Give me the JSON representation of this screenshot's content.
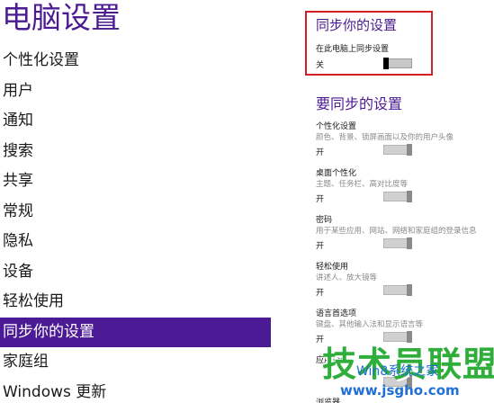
{
  "nav": {
    "title": "电脑设置",
    "items": [
      {
        "label": "个性化设置"
      },
      {
        "label": "用户"
      },
      {
        "label": "通知"
      },
      {
        "label": "搜索"
      },
      {
        "label": "共享"
      },
      {
        "label": "常规"
      },
      {
        "label": "隐私"
      },
      {
        "label": "设备"
      },
      {
        "label": "轻松使用"
      },
      {
        "label": "同步你的设置",
        "selected": true
      },
      {
        "label": "家庭组"
      },
      {
        "label": "Windows 更新"
      }
    ]
  },
  "sync": {
    "title": "同步你的设置",
    "toggle_label": "在此电脑上同步设置",
    "state": "关"
  },
  "what_to_sync": {
    "title": "要同步的设置",
    "items": [
      {
        "label": "个性化设置",
        "description": "颜色、背景、锁屏画面以及你的用户头像",
        "state": "开"
      },
      {
        "label": "桌面个性化",
        "description": "主题、任务栏、高对比度等",
        "state": "开"
      },
      {
        "label": "密码",
        "description": "用于某些应用、网站、网络和家庭组的登录信息",
        "state": "开"
      },
      {
        "label": "轻松使用",
        "description": "讲述人、放大镜等",
        "state": "开"
      },
      {
        "label": "语言首选项",
        "description": "键盘、其他输入法和显示语言等",
        "state": "开"
      },
      {
        "label": "应用设置"
      },
      {
        "label": "浏览器"
      }
    ]
  },
  "watermark": {
    "big": "技术员联盟",
    "mid": "Win8系统之家",
    "url": "www.jsgho.com"
  },
  "colors": {
    "accent": "#4b1b91",
    "selected_bg": "#4c1a95",
    "highlight_border": "#d32027"
  }
}
